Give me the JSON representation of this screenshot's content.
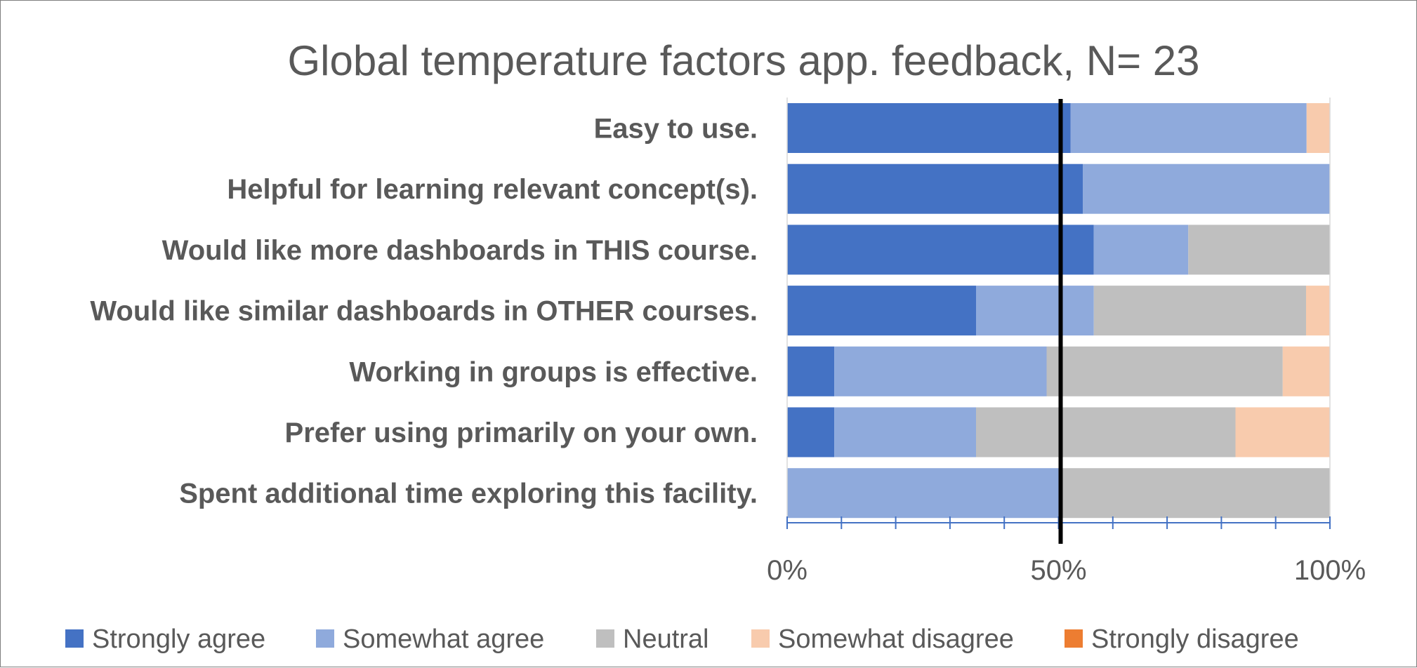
{
  "chart_data": {
    "type": "bar",
    "orientation": "horizontal",
    "stacked": "100%",
    "title": "Global temperature factors app. feedback, N= 23",
    "categories": [
      "Easy to use.",
      "Helpful for learning relevant concept(s).",
      "Would like more dashboards in THIS course.",
      "Would like similar dashboards in OTHER courses.",
      "Working in groups is effective.",
      "Prefer using primarily on your own.",
      "Spent additional time exploring this facility."
    ],
    "series": [
      {
        "name": "Strongly agree",
        "color": "#4472c4",
        "values": [
          52.2,
          54.5,
          56.5,
          34.8,
          8.7,
          8.7,
          0
        ]
      },
      {
        "name": "Somewhat agree",
        "color": "#8faadc",
        "values": [
          43.5,
          45.5,
          17.4,
          21.7,
          39.1,
          26.1,
          50
        ]
      },
      {
        "name": "Neutral",
        "color": "#bfbfbf",
        "values": [
          0,
          0,
          26.1,
          39.1,
          43.5,
          47.8,
          50
        ]
      },
      {
        "name": "Somewhat disagree",
        "color": "#f8cbad",
        "values": [
          4.3,
          0,
          0,
          4.3,
          8.7,
          17.4,
          0
        ]
      },
      {
        "name": "Strongly disagree",
        "color": "#ed7d31",
        "values": [
          0,
          0,
          0,
          0,
          0,
          0,
          0
        ]
      }
    ],
    "xlim": [
      0,
      100
    ],
    "x_ticks": [
      "0%",
      "50%",
      "100%"
    ],
    "reference_line": 50,
    "grid": false,
    "legend_position": "bottom"
  }
}
